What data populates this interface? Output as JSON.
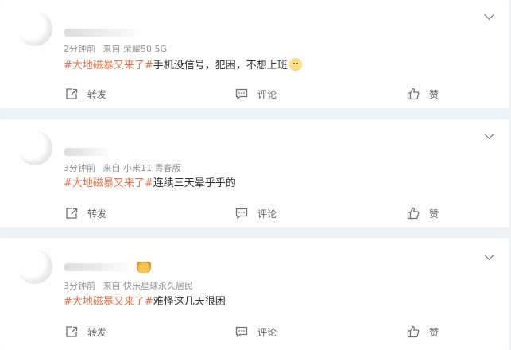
{
  "feed": {
    "actions": {
      "repost": "转发",
      "comment": "评论",
      "like": "赞"
    },
    "items": [
      {
        "time": "2分钟前",
        "source": "来自 荣耀50 5G",
        "topic": "#大地磁暴又来了#",
        "text": "手机没信号，犯困，不想上班",
        "has_emoji": true
      },
      {
        "time": "3分钟前",
        "source": "来自 小米11 青春版",
        "topic": "#大地磁暴又来了#",
        "text": "连续三天晕乎乎的",
        "has_emoji": false
      },
      {
        "time": "3分钟前",
        "source": "来自 快乐星球永久居民",
        "topic": "#大地磁暴又来了#",
        "text": "难怪这几天很困",
        "has_emoji": false,
        "badge": "crown-icon"
      }
    ]
  },
  "colors": {
    "topic": "#eb7350",
    "meta": "#939393",
    "text": "#333333",
    "background": "#f1f2f5"
  }
}
